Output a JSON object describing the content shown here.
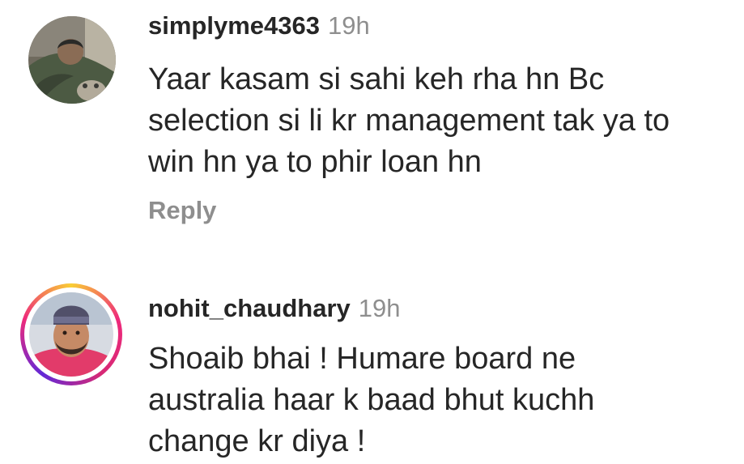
{
  "comments": [
    {
      "username": "simplyme4363",
      "time": "19h",
      "lines": [
        "Yaar kasam si sahi keh rha hn Bc",
        "selection si li kr management tak ya to",
        "win hn ya to phir loan hn"
      ],
      "reply_label": "Reply"
    },
    {
      "username": "nohit_chaudhary",
      "time": "19h",
      "lines": [
        "Shoaib bhai ! Humare board ne",
        "australia haar k baad bhut kuchh",
        "change kr diya !"
      ]
    }
  ]
}
